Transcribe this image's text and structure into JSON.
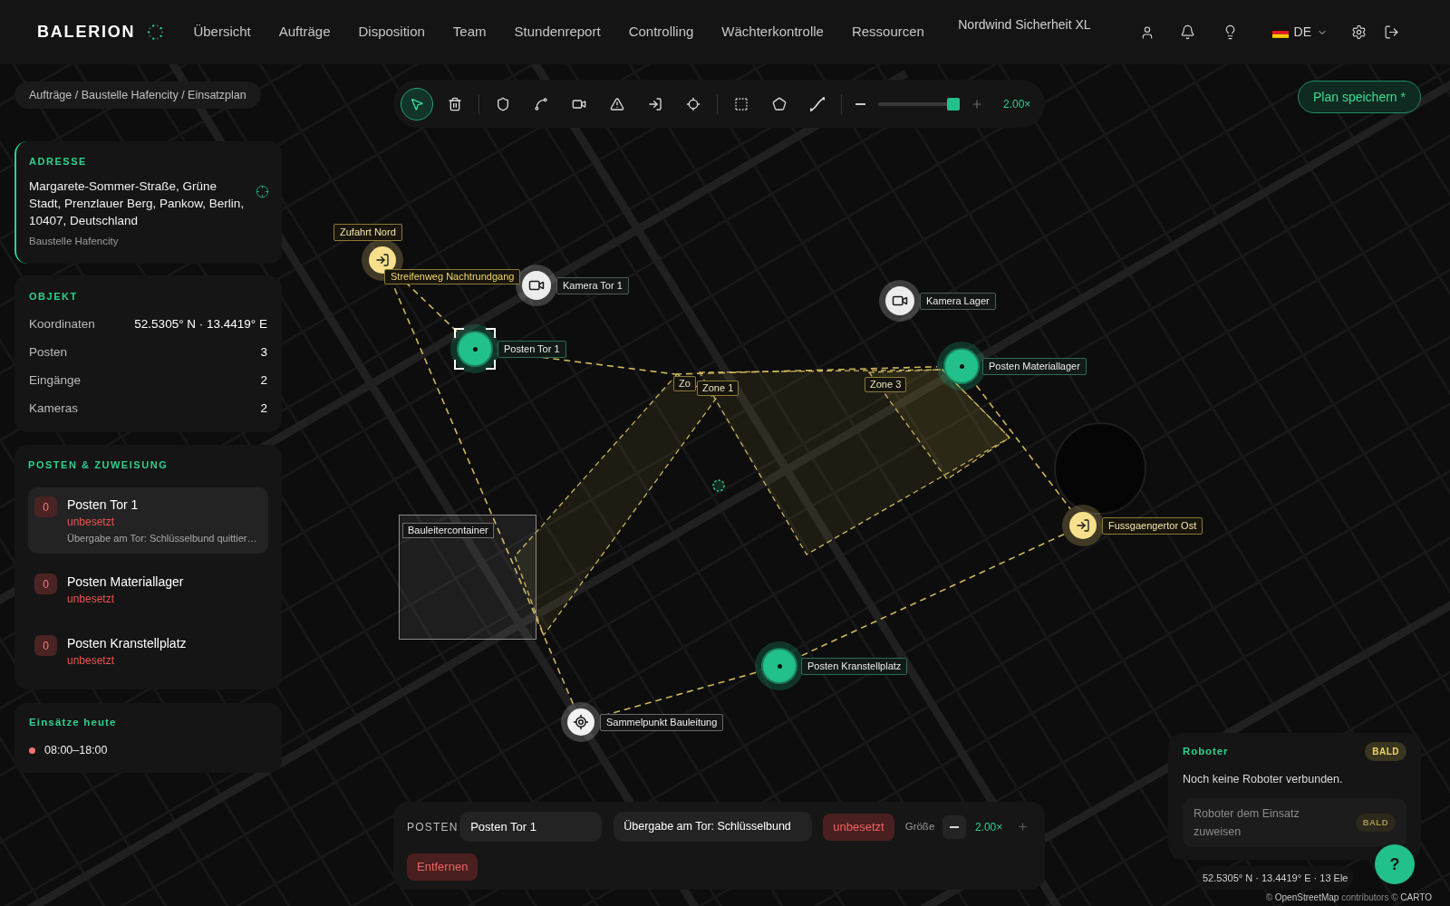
{
  "header": {
    "logo": "BALERION",
    "nav": [
      {
        "label": "Übersicht",
        "selected": false
      },
      {
        "label": "Aufträge",
        "selected": false
      },
      {
        "label": "Disposition",
        "selected": false
      },
      {
        "label": "Team",
        "selected": false
      },
      {
        "label": "Stundenreport",
        "selected": false
      },
      {
        "label": "Controlling",
        "selected": false
      },
      {
        "label": "Wächterkontrolle",
        "selected": false
      },
      {
        "label": "Ressourcen",
        "selected": false
      }
    ],
    "company": "Nordwind Sicherheit XL",
    "language": "DE"
  },
  "breadcrumb": "Aufträge / Baustelle Hafencity / Einsatzplan",
  "toolbar": {
    "groups": [
      {
        "tools": [
          {
            "kind": "select",
            "selected": true
          },
          {
            "kind": "delete",
            "selected": false
          }
        ]
      },
      {
        "tools": [
          {
            "kind": "post",
            "selected": false
          },
          {
            "kind": "route",
            "selected": false
          },
          {
            "kind": "camera",
            "selected": false
          },
          {
            "kind": "hazard",
            "selected": false
          },
          {
            "kind": "entrance",
            "selected": false
          },
          {
            "kind": "assembly",
            "selected": false
          }
        ]
      },
      {
        "tools": [
          {
            "kind": "area",
            "selected": false
          },
          {
            "kind": "zone",
            "selected": false
          },
          {
            "kind": "path",
            "selected": false
          }
        ]
      }
    ],
    "zoom": {
      "level": 1,
      "reading": "2.00×"
    }
  },
  "save_button": "Plan speichern *",
  "sidebar": {
    "address": {
      "title": "ADRESSE",
      "text": "Margarete-Sommer-Straße, Grüne Stadt, Prenzlauer Berg, Pankow, Berlin, 10407, Deutschland",
      "site": "Baustelle Hafencity"
    },
    "object": {
      "title": "OBJEKT",
      "rows": [
        {
          "label": "Koordinaten",
          "value": "52.5305° N · 13.4419° E"
        },
        {
          "label": "Posten",
          "value": "3"
        },
        {
          "label": "Eingänge",
          "value": "2"
        },
        {
          "label": "Kameras",
          "value": "2"
        }
      ]
    },
    "posts": {
      "title": "POSTEN & ZUWEISUNG",
      "items": [
        {
          "count": "0",
          "name": "Posten Tor 1",
          "status": "unbesetzt",
          "note": "Übergabe am Tor: Schlüsselbund quittier…",
          "selected": true
        },
        {
          "count": "0",
          "name": "Posten Materiallager",
          "status": "unbesetzt",
          "selected": false
        },
        {
          "count": "0",
          "name": "Posten Kranstellplatz",
          "status": "unbesetzt",
          "selected": false
        }
      ]
    },
    "shifts": {
      "title": "Einsätze heute",
      "items": [
        {
          "time": "08:00–18:00",
          "color": "#f87171"
        }
      ]
    }
  },
  "map": {
    "markers": [
      {
        "kind": "entrance",
        "label": "Zufahrt Nord",
        "selected": false
      },
      {
        "kind": "camera",
        "label": "Kamera Tor 1",
        "selected": false
      },
      {
        "kind": "post",
        "label": "Posten Tor 1",
        "selected": true
      },
      {
        "kind": "camera",
        "label": "Kamera Lager",
        "selected": false
      },
      {
        "kind": "post",
        "label": "Posten Materiallager",
        "selected": false
      },
      {
        "kind": "entrance",
        "label": "Fussgaengertor Ost",
        "selected": false
      },
      {
        "kind": "post",
        "label": "Posten Kranstellplatz",
        "selected": false
      },
      {
        "kind": "assembly",
        "label": "Sammelpunkt Bauleitung",
        "selected": false
      }
    ],
    "route_label": "Streifenweg Nachtrundgang",
    "zones": [
      {
        "label": "Zo"
      },
      {
        "label": "Zone 1"
      },
      {
        "label": "Zone 3"
      }
    ],
    "area": {
      "label": "Bauleitercontainer"
    }
  },
  "editor": {
    "title": "POSTEN",
    "name_value": "Posten Tor 1",
    "note_value": "Übergabe am Tor: Schlüsselbund",
    "status": "unbesetzt",
    "size_label": "Größe",
    "size_reading": "2.00×",
    "remove": "Entfernen"
  },
  "robots": {
    "title": "Roboter",
    "badge": "BALD",
    "message": "Noch keine Roboter verbunden.",
    "action": {
      "label": "Roboter dem Einsatz zuweisen",
      "badge": "BALD",
      "disabled": true
    }
  },
  "status": {
    "coordinates": "52.5305° N · 13.4419° E · 13 Ele",
    "help": "?",
    "attribution": [
      {
        "text": "©",
        "kind": "text"
      },
      {
        "text": "OpenStreetMap",
        "kind": "link"
      },
      {
        "text": "contributors ©",
        "kind": "text"
      },
      {
        "text": "CARTO",
        "kind": "link"
      }
    ]
  }
}
